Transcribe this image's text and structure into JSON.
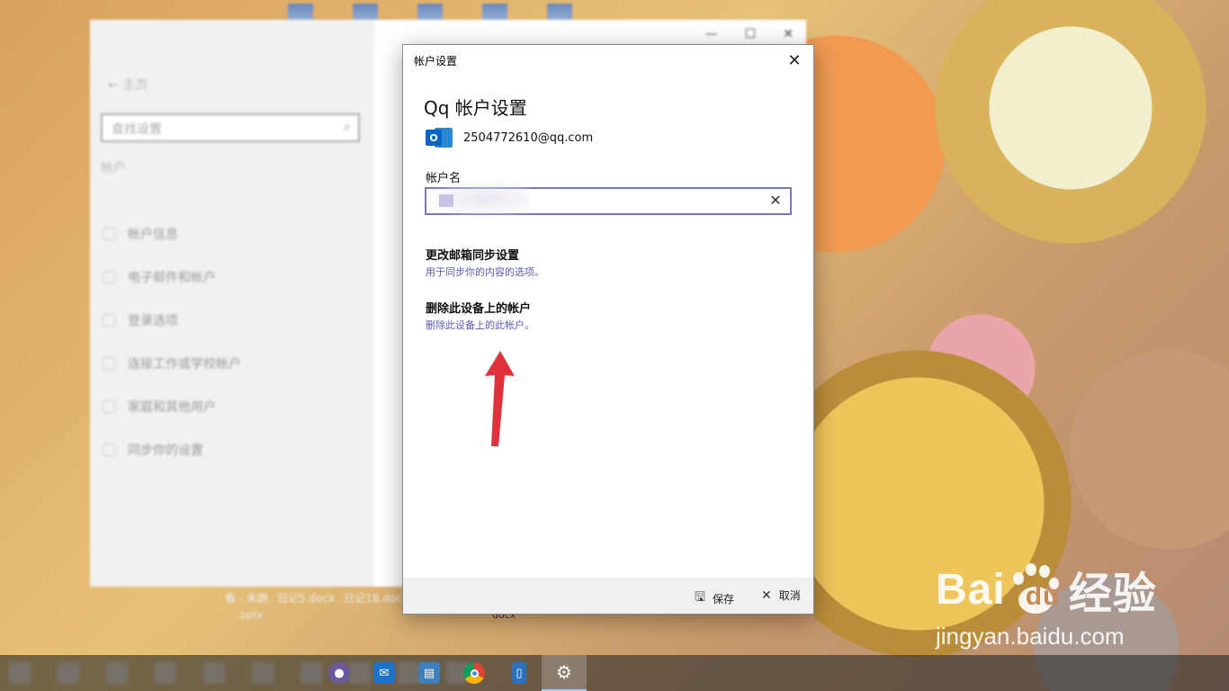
{
  "dialog": {
    "window_title": "帐户设置",
    "heading": "Qq 帐户设置",
    "account_email": "2504772610@qq.com",
    "account_name_label": "帐户名",
    "account_name_value": "",
    "sync_title": "更改邮箱同步设置",
    "sync_subtitle": "用于同步你的内容的选项。",
    "remove_title": "删除此设备上的帐户",
    "remove_subtitle": "删除此设备上的此帐户。",
    "save_label": "保存",
    "cancel_label": "取消"
  },
  "background_settings": {
    "back_label": "主页",
    "search_placeholder": "查找设置",
    "section_label": "帐户",
    "nav_items": [
      "帐户信息",
      "电子邮件和帐户",
      "登录选项",
      "连接工作或学校帐户",
      "家庭和其他用户",
      "同步你的设置"
    ]
  },
  "desktop_files": {
    "row1": [
      "春 - 朱朗",
      "日记5.docx",
      "日记18.docx"
    ],
    "row2": ".pptx",
    "row3": "docx"
  },
  "taskbar": {
    "apps": [
      "record-icon",
      "mail-icon",
      "news-icon",
      "chrome-icon",
      "phone-icon",
      "settings-icon"
    ]
  },
  "watermark": {
    "brand": "Bai",
    "brand_suffix": "du",
    "brand_cn": "经验",
    "url": "jingyan.baidu.com"
  },
  "colors": {
    "accent": "#7777c3",
    "link_sub": "#5b5bb5",
    "arrow": "#e0323c"
  }
}
